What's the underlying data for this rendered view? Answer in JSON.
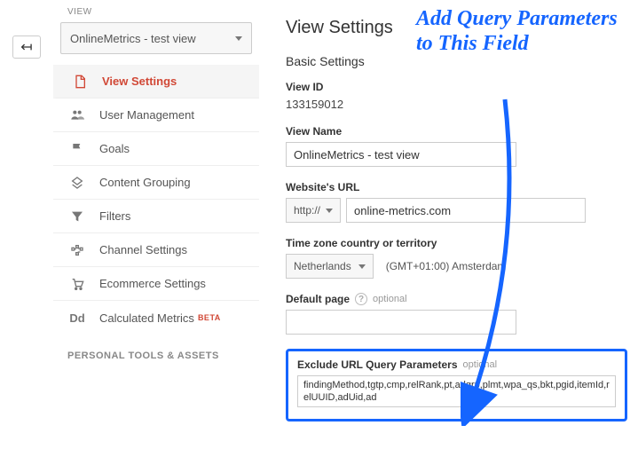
{
  "sidebar": {
    "section_label": "VIEW",
    "view_name": "OnlineMetrics - test view",
    "nav": {
      "view_settings": "View Settings",
      "user_management": "User Management",
      "goals": "Goals",
      "content_grouping": "Content Grouping",
      "filters": "Filters",
      "channel_settings": "Channel Settings",
      "ecommerce_settings": "Ecommerce Settings",
      "calculated_metrics": "Calculated Metrics",
      "beta_badge": "BETA"
    },
    "tools_header": "PERSONAL TOOLS & ASSETS"
  },
  "main": {
    "title": "View Settings",
    "subtitle": "Basic Settings",
    "view_id_label": "View ID",
    "view_id_value": "133159012",
    "view_name_label": "View Name",
    "view_name_value": "OnlineMetrics - test view",
    "url_label": "Website's URL",
    "protocol": "http://",
    "url_value": "online-metrics.com",
    "tz_label": "Time zone country or territory",
    "tz_country": "Netherlands",
    "tz_offset": "(GMT+01:00) Amsterdam",
    "default_page_label": "Default page",
    "optional": "optional",
    "default_page_value": "",
    "exclude_label": "Exclude URL Query Parameters",
    "exclude_value": "findingMethod,tgtp,cmp,relRank,pt,adgrp,plmt,wpa_qs,bkt,pgid,itemId,relUUID,adUid,ad"
  },
  "annotation": {
    "text": "Add Query Parameters to This Field"
  }
}
